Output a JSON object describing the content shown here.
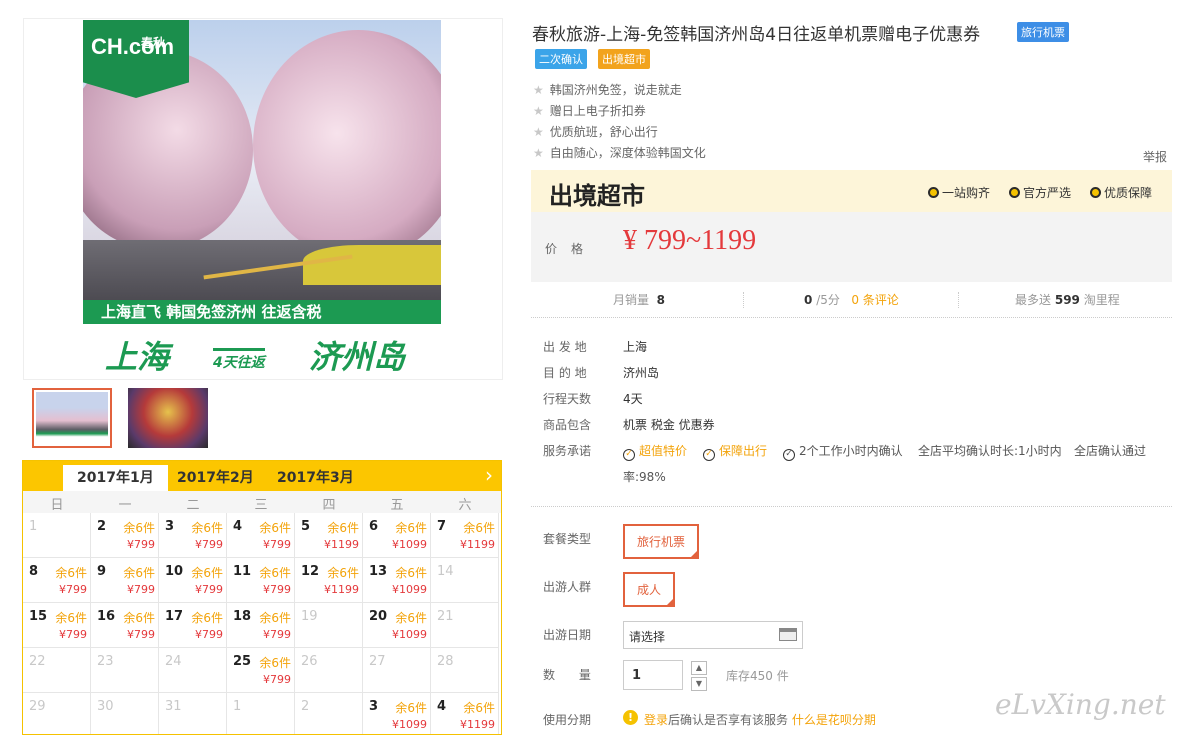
{
  "product": {
    "title": "春秋旅游-上海-免签韩国济州岛4日往返单机票赠电子优惠券",
    "category_tag": "旅行机票",
    "tags": [
      "二次确认",
      "出境超市"
    ],
    "features": [
      "韩国济州免签，说走就走",
      "赠日上电子折扣券",
      "优质航班，舒心出行",
      "自由随心，深度体验韩国文化"
    ],
    "report": "举报"
  },
  "image": {
    "logo_main": "CH.com",
    "logo_cn": "春秋",
    "banner_top": "上海直飞  韩国免签济州 往返含税",
    "banner_from": "上海",
    "banner_mid": "4天往返",
    "banner_to": "济州岛"
  },
  "shop": {
    "name": "出境超市",
    "guarantees": [
      "一站购齐",
      "官方严选",
      "优质保障"
    ],
    "price_label": "价格",
    "price": "¥ 799~1199"
  },
  "stats": {
    "monthly_label": "月销量",
    "monthly_value": "8",
    "score": "0",
    "score_unit": "/5分",
    "reviews": "0 条评论",
    "points_pre": "最多送",
    "points": "599",
    "points_post": "淘里程"
  },
  "info": {
    "depart_label": "出 发 地",
    "depart": "上海",
    "dest_label": "目 的 地",
    "dest": "济州岛",
    "days_label": "行程天数",
    "days": "4天",
    "includes_label": "商品包含",
    "includes": "机票  税金  优惠券",
    "promise_label": "服务承诺",
    "promises": [
      "超值特价",
      "保障出行",
      "2个工作小时内确认"
    ],
    "promise_avg": "全店平均确认时长:1小时内",
    "promise_rate": "全店确认通过",
    "promise_rate2": "率:98%"
  },
  "options": {
    "package_label": "套餐类型",
    "package": "旅行机票",
    "crowd_label": "出游人群",
    "crowd": "成人",
    "date_label": "出游日期",
    "date_placeholder": "请选择",
    "qty_label": "数  量",
    "qty": "1",
    "stock": "库存450 件",
    "installment_label": "使用分期",
    "installment_link": "登录",
    "installment_text": "后确认是否享有该服务",
    "installment_help": "什么是花呗分期"
  },
  "calendar": {
    "tabs": [
      "2017年1月",
      "2017年2月",
      "2017年3月"
    ],
    "weekdays": [
      "日",
      "一",
      "二",
      "三",
      "四",
      "五",
      "六"
    ],
    "next": "›",
    "cells": [
      {
        "d": "1",
        "off": true
      },
      {
        "d": "2",
        "s": "余6件",
        "p": "¥799"
      },
      {
        "d": "3",
        "s": "余6件",
        "p": "¥799"
      },
      {
        "d": "4",
        "s": "余6件",
        "p": "¥799"
      },
      {
        "d": "5",
        "s": "余6件",
        "p": "¥1199"
      },
      {
        "d": "6",
        "s": "余6件",
        "p": "¥1099"
      },
      {
        "d": "7",
        "s": "余6件",
        "p": "¥1199"
      },
      {
        "d": "8",
        "s": "余6件",
        "p": "¥799"
      },
      {
        "d": "9",
        "s": "余6件",
        "p": "¥799"
      },
      {
        "d": "10",
        "s": "余6件",
        "p": "¥799"
      },
      {
        "d": "11",
        "s": "余6件",
        "p": "¥799"
      },
      {
        "d": "12",
        "s": "余6件",
        "p": "¥1199"
      },
      {
        "d": "13",
        "s": "余6件",
        "p": "¥1099"
      },
      {
        "d": "14",
        "off": true
      },
      {
        "d": "15",
        "s": "余6件",
        "p": "¥799"
      },
      {
        "d": "16",
        "s": "余6件",
        "p": "¥799"
      },
      {
        "d": "17",
        "s": "余6件",
        "p": "¥799"
      },
      {
        "d": "18",
        "s": "余6件",
        "p": "¥799"
      },
      {
        "d": "19",
        "off": true
      },
      {
        "d": "20",
        "s": "余6件",
        "p": "¥1099"
      },
      {
        "d": "21",
        "off": true
      },
      {
        "d": "22",
        "off": true
      },
      {
        "d": "23",
        "off": true
      },
      {
        "d": "24",
        "off": true
      },
      {
        "d": "25",
        "s": "余6件",
        "p": "¥799"
      },
      {
        "d": "26",
        "off": true
      },
      {
        "d": "27",
        "off": true
      },
      {
        "d": "28",
        "off": true
      },
      {
        "d": "29",
        "off": true
      },
      {
        "d": "30",
        "off": true
      },
      {
        "d": "31",
        "off": true
      },
      {
        "d": "1",
        "off": true
      },
      {
        "d": "2",
        "off": true
      },
      {
        "d": "3",
        "s": "余6件",
        "p": "¥1099"
      },
      {
        "d": "4",
        "s": "余6件",
        "p": "¥1199"
      }
    ]
  },
  "watermark": "eLvXing.net",
  "colors": {
    "accent": "#e4393c",
    "orange": "#f3a30a",
    "yellow": "#fcc600",
    "green": "#1c9a52"
  }
}
